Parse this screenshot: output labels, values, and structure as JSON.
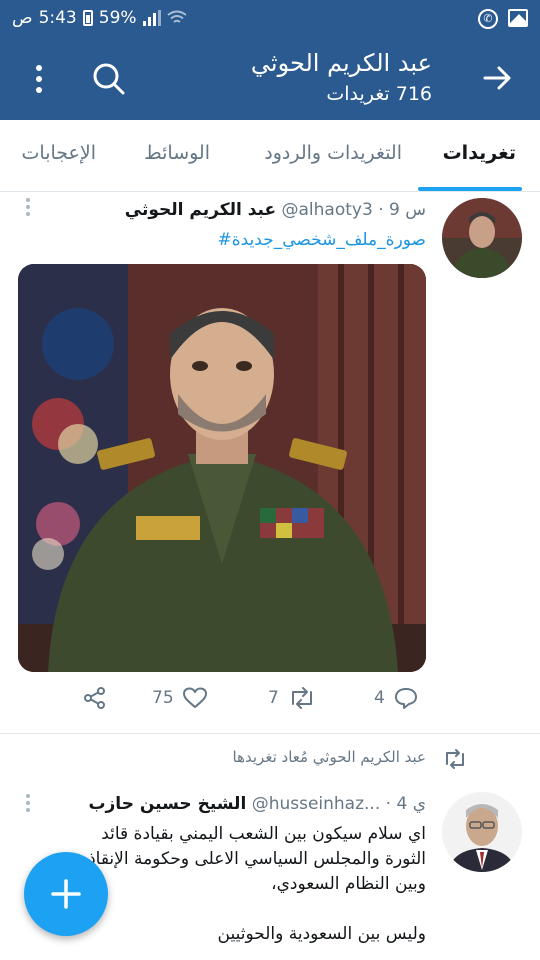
{
  "status_bar": {
    "time": "5:43",
    "time_suffix": "ص",
    "battery": "59%"
  },
  "header": {
    "title": "عبد الكريم الحوثي",
    "subtitle": "716 تغريدات"
  },
  "tabs": [
    {
      "label": "تغريدات",
      "active": true
    },
    {
      "label": "التغريدات والردود",
      "active": false
    },
    {
      "label": "الوسائط",
      "active": false
    },
    {
      "label": "الإعجابات",
      "active": false
    }
  ],
  "tweets": [
    {
      "author": "عبد الكريم الحوثي",
      "handle": "@alhaoty3",
      "time": "9 س",
      "text": "#صورة_ملف_شخصي_جديدة",
      "stats": {
        "replies": "4",
        "retweets": "7",
        "likes": "75"
      }
    },
    {
      "retweeted_by": "عبد الكريم الحوثي مُعاد تغريدها",
      "author": "الشيخ حسين  حازب",
      "handle": "@husseinhaz...",
      "time": "4 ي",
      "lines": [
        "اي سلام سيكون بين الشعب اليمني بقيادة قائد",
        "الثورة والمجلس السياسي الاعلى وحكومة الإنقاذ",
        "وبين النظام السعودي،",
        "",
        "وليس بين السعودية والحوثيين"
      ]
    }
  ],
  "colors": {
    "header_bg": "#2a5a8f",
    "accent": "#1da1f2",
    "muted": "#657786"
  },
  "icons": [
    "back-arrow-icon",
    "search-icon",
    "more-vertical-icon",
    "reply-icon",
    "retweet-icon",
    "like-icon",
    "share-icon",
    "plus-icon"
  ]
}
